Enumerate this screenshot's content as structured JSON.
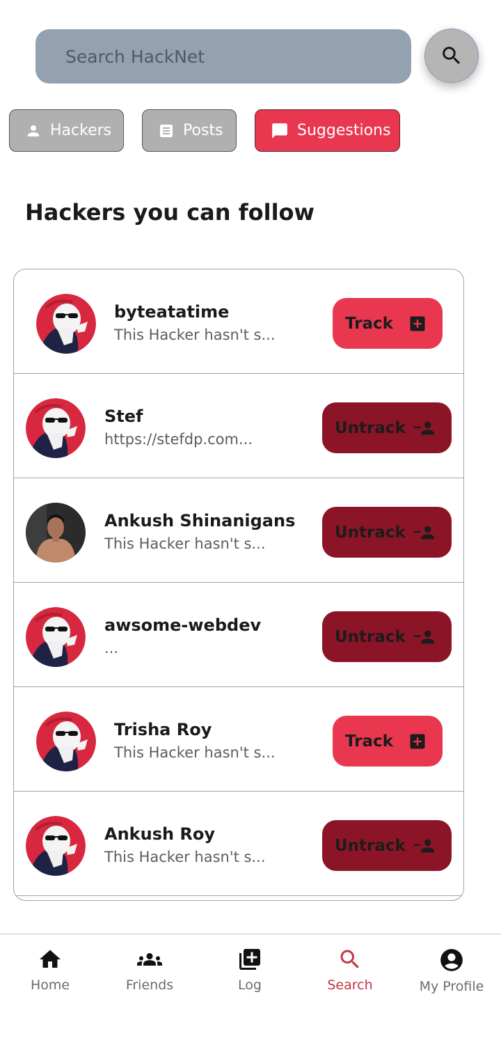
{
  "search": {
    "placeholder": "Search HackNet"
  },
  "filters": [
    {
      "label": "Hackers",
      "icon": "person-icon",
      "active": false
    },
    {
      "label": "Posts",
      "icon": "article-icon",
      "active": false
    },
    {
      "label": "Suggestions",
      "icon": "chat-bubble-icon",
      "active": true
    }
  ],
  "section": {
    "title": "Hackers you can follow"
  },
  "hackers": [
    {
      "name": "byteatatime",
      "bio": "This Hacker hasn't s...",
      "action": "Track",
      "action_icon": "add-box-icon"
    },
    {
      "name": "Stef",
      "bio": "https://stefdp.com...",
      "action": "Untrack",
      "action_icon": "person-remove-icon"
    },
    {
      "name": "Ankush Shinanigans",
      "bio": "This Hacker hasn't s...",
      "action": "Untrack",
      "action_icon": "person-remove-icon"
    },
    {
      "name": "awsome-webdev",
      "bio": "...",
      "action": "Untrack",
      "action_icon": "person-remove-icon"
    },
    {
      "name": "Trisha Roy",
      "bio": "This Hacker hasn't s...",
      "action": "Track",
      "action_icon": "add-box-icon"
    },
    {
      "name": "Ankush Roy",
      "bio": "This Hacker hasn't s...",
      "action": "Untrack",
      "action_icon": "person-remove-icon"
    }
  ],
  "nav": [
    {
      "label": "Home",
      "icon": "home-icon",
      "active": false
    },
    {
      "label": "Friends",
      "icon": "group-icon",
      "active": false
    },
    {
      "label": "Log",
      "icon": "add-post-icon",
      "active": false
    },
    {
      "label": "Search",
      "icon": "search-icon",
      "active": true
    },
    {
      "label": "My Profile",
      "icon": "account-circle-icon",
      "active": false
    }
  ],
  "colors": {
    "accent": "#e8374f",
    "untrack": "#8b1426",
    "search_bar": "#94a1b1",
    "chip_inactive": "#b0b0b0",
    "nav_active": "#c73346"
  }
}
